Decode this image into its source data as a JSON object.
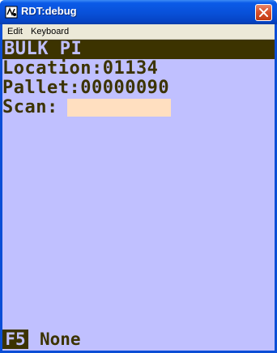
{
  "window": {
    "title": "RDT:debug",
    "icon": "rdt-app-icon",
    "close_icon": "close-icon"
  },
  "menu": {
    "items": [
      {
        "label": "Edit"
      },
      {
        "label": "Keyboard"
      }
    ]
  },
  "screen": {
    "header": "BULK PI",
    "location_line": "Location:01134",
    "pallet_line": "Pallet:00000090",
    "scan_label": "Scan:",
    "scan_value": ""
  },
  "fkeys": [
    {
      "key": "F5",
      "action": "None"
    }
  ],
  "colors": {
    "terminal_background": "#c0c0ff",
    "terminal_text": "#3c3300",
    "input_background": "#ffdfc0",
    "titlebar": "#0850d8",
    "close_button": "#d9512c"
  }
}
